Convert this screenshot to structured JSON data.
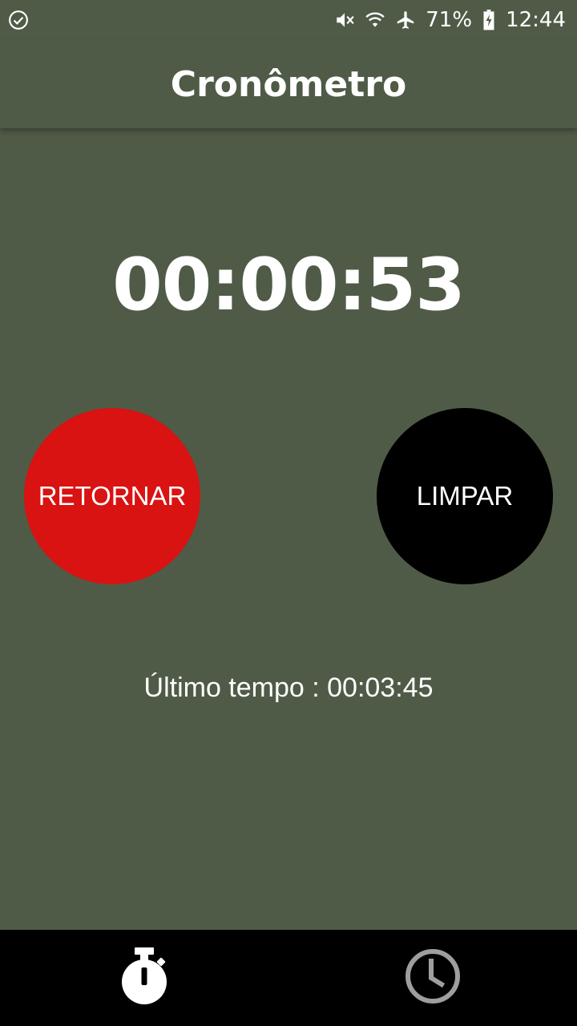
{
  "status_bar": {
    "battery": "71%",
    "time": "12:44",
    "icons": [
      "check-circle-icon",
      "mute-icon",
      "wifi-icon",
      "airplane-icon",
      "battery-charging-icon"
    ]
  },
  "app_bar": {
    "title": "Cronômetro"
  },
  "timer": {
    "display": "00:00:53"
  },
  "buttons": {
    "return_label": "RETORNAR",
    "clear_label": "LIMPAR"
  },
  "last_time": {
    "text": "Último tempo : 00:03:45"
  },
  "bottom_nav": {
    "items": [
      {
        "icon": "stopwatch-icon",
        "active": true
      },
      {
        "icon": "clock-icon",
        "active": false
      }
    ]
  },
  "colors": {
    "background": "#4f5b47",
    "return_button": "#d91212",
    "clear_button": "#000000",
    "nav_bar": "#000000",
    "nav_active": "#ffffff",
    "nav_inactive": "#9e9e9e"
  }
}
